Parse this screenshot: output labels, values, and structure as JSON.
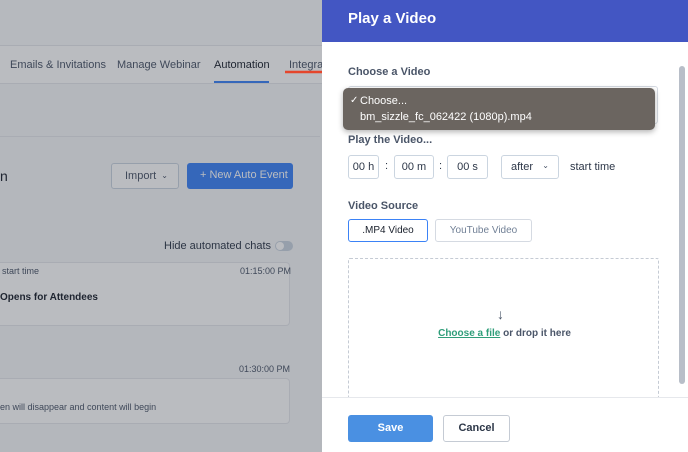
{
  "background": {
    "tabs": [
      {
        "label": "Emails & Invitations"
      },
      {
        "label": "Manage Webinar"
      },
      {
        "label": "Automation"
      },
      {
        "label": "Integra"
      }
    ],
    "heading_fragment": "n",
    "import_label": "Import",
    "new_event_label": "+ New Auto Event",
    "hide_label": "Hide automated chats",
    "event1": {
      "trigger": "start time",
      "time": "01:15:00 PM",
      "title": "Opens for Attendees"
    },
    "event2": {
      "time": "01:30:00 PM",
      "description": "en will disappear and content will begin"
    }
  },
  "panel": {
    "title": "Play a Video",
    "choose_label": "Choose a Video",
    "dropdown": {
      "options": [
        {
          "label": "Choose...",
          "check": "✓"
        },
        {
          "label": "bm_sizzle_fc_062422 (1080p).mp4",
          "check": ""
        }
      ]
    },
    "play_label": "Play the Video...",
    "time": {
      "hours": "00 h",
      "minutes": "00  m",
      "seconds": "00  s",
      "separator": ":"
    },
    "relation": "after",
    "start_time_label": "start time",
    "source_label": "Video Source",
    "source_buttons": {
      "mp4": ".MP4 Video",
      "youtube": "YouTube Video"
    },
    "dropzone": {
      "arrow": "↓",
      "link": "Choose a file",
      "rest": " or drop it here"
    },
    "footer": {
      "save": "Save",
      "cancel": "Cancel"
    }
  },
  "colors": {
    "header": "#4356c3",
    "primary": "#4a90e2",
    "link": "#2f9e7a",
    "arrow": "#e5462c"
  }
}
